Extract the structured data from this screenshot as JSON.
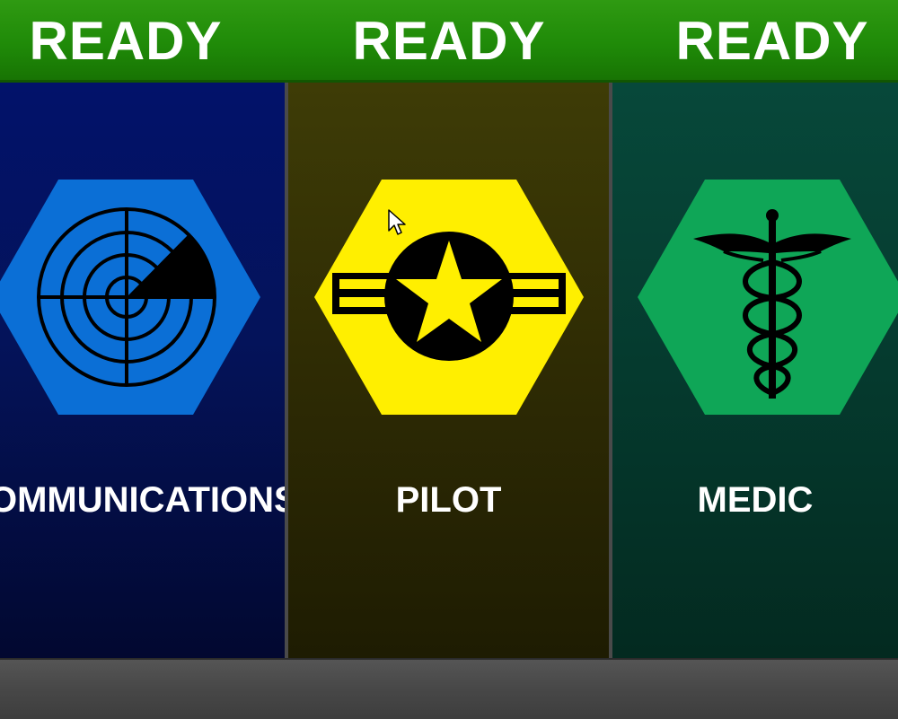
{
  "status_bar": {
    "slots": [
      {
        "label": "READY"
      },
      {
        "label": "READY"
      },
      {
        "label": "READY"
      }
    ],
    "color": "#1f8a08"
  },
  "roles": [
    {
      "name": "OMMUNICATIONS",
      "emblem": "radar-icon",
      "hex_color": "#0b6fd6",
      "panel_color": "#02126a"
    },
    {
      "name": "PILOT",
      "emblem": "star-roundel-icon",
      "hex_color": "#ffef00",
      "panel_color": "#3e3c06"
    },
    {
      "name": "MEDIC",
      "emblem": "caduceus-icon",
      "hex_color": "#0fa657",
      "panel_color": "#07483a"
    }
  ]
}
